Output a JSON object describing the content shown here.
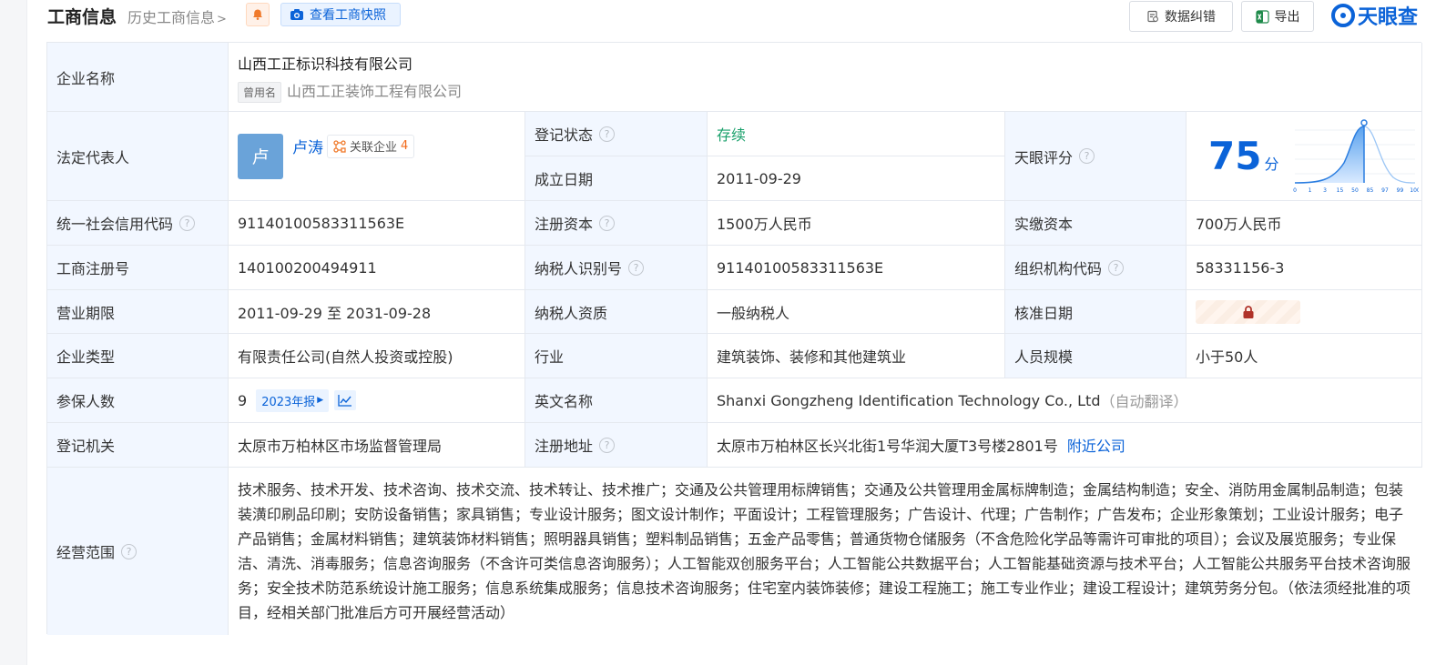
{
  "header": {
    "title": "工商信息",
    "history_link": "历史工商信息",
    "snapshot_button": "查看工商快照",
    "data_fix_button": "数据纠错",
    "export_button": "导出",
    "logo_text": "天眼查"
  },
  "labels": {
    "company_name": "企业名称",
    "legal_rep": "法定代表人",
    "reg_status": "登记状态",
    "established": "成立日期",
    "tianyan_score": "天眼评分",
    "credit_code": "统一社会信用代码",
    "reg_capital": "注册资本",
    "paid_capital": "实缴资本",
    "business_reg_no": "工商注册号",
    "taxpayer_id": "纳税人识别号",
    "org_code": "组织机构代码",
    "business_term": "营业期限",
    "taxpayer_qual": "纳税人资质",
    "approval_date": "核准日期",
    "company_type": "企业类型",
    "industry": "行业",
    "staff_size": "人员规模",
    "insured_count": "参保人数",
    "english_name": "英文名称",
    "reg_authority": "登记机关",
    "reg_address": "注册地址",
    "business_scope": "经营范围"
  },
  "company": {
    "name": "山西工正标识科技有限公司",
    "former_tag": "曾用名",
    "former_name": "山西工正装饰工程有限公司",
    "legal_rep_avatar": "卢",
    "legal_rep_name": "卢涛",
    "related_label": "关联企业",
    "related_count": "4",
    "reg_status": "存续",
    "established": "2011-09-29",
    "score": "75",
    "score_unit": "分",
    "credit_code": "91140100583311563E",
    "reg_capital": "1500万人民币",
    "paid_capital": "700万人民币",
    "business_reg_no": "140100200494911",
    "taxpayer_id": "91140100583311563E",
    "org_code": "58331156-3",
    "business_term": "2011-09-29 至 2031-09-28",
    "taxpayer_qual": "一般纳税人",
    "company_type": "有限责任公司(自然人投资或控股)",
    "industry": "建筑装饰、装修和其他建筑业",
    "staff_size": "小于50人",
    "insured_count": "9",
    "annual_report": "2023年报",
    "english_name": "Shanxi Gongzheng Identification Technology Co., Ltd",
    "auto_translate": "（自动翻译）",
    "reg_authority": "太原市万柏林区市场监督管理局",
    "reg_address": "太原市万柏林区长兴北街1号华润大厦T3号楼2801号",
    "nearby_link": "附近公司",
    "business_scope": "技术服务、技术开发、技术咨询、技术交流、技术转让、技术推广；交通及公共管理用标牌销售；交通及公共管理用金属标牌制造；金属结构制造；安全、消防用金属制品制造；包装装潢印刷品印刷；安防设备销售；家具销售；专业设计服务；图文设计制作；平面设计；工程管理服务；广告设计、代理；广告制作；广告发布；企业形象策划；工业设计服务；电子产品销售；金属材料销售；建筑装饰材料销售；照明器具销售；塑料制品销售；五金产品零售；普通货物仓储服务（不含危险化学品等需许可审批的项目）；会议及展览服务；专业保洁、清洗、消毒服务；信息咨询服务（不含许可类信息咨询服务）；人工智能双创服务平台；人工智能公共数据平台；人工智能基础资源与技术平台；人工智能公共服务平台技术咨询服务；安全技术防范系统设计施工服务；信息系统集成服务；信息技术咨询服务；住宅室内装饰装修；建设工程施工；施工专业作业；建设工程设计；建筑劳务分包。（依法须经批准的项目，经相关部门批准后方可开展经营活动）"
  },
  "score_chart": {
    "ticks": [
      "0",
      "1",
      "3",
      "15",
      "50",
      "85",
      "97",
      "99",
      "100"
    ]
  },
  "colors": {
    "brand_blue": "#0b63d8",
    "status_green": "#19a06b",
    "label_bg": "#f2f7ff"
  }
}
